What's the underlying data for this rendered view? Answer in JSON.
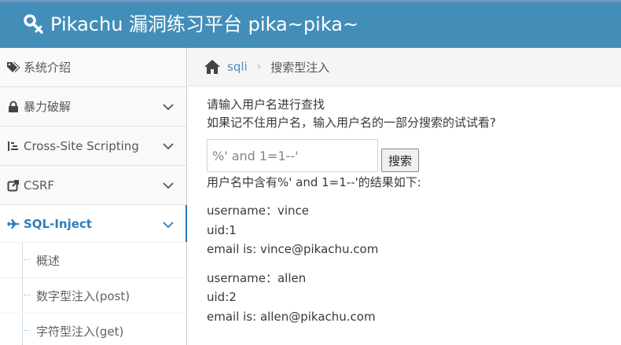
{
  "header": {
    "title": "Pikachu 漏洞练习平台 pika~pika~"
  },
  "sidebar": {
    "items": [
      {
        "label": "系统介绍",
        "icon": "tags-icon",
        "has_chevron": false
      },
      {
        "label": "暴力破解",
        "icon": "lock-icon",
        "has_chevron": true
      },
      {
        "label": "Cross-Site Scripting",
        "icon": "list-icon",
        "has_chevron": true
      },
      {
        "label": "CSRF",
        "icon": "share-icon",
        "has_chevron": true
      },
      {
        "label": "SQL-Inject",
        "icon": "plane-icon",
        "has_chevron": true,
        "active": true
      }
    ],
    "sub_items": [
      {
        "label": "概述"
      },
      {
        "label": "数字型注入(post)"
      },
      {
        "label": "字符型注入(get)"
      }
    ]
  },
  "breadcrumb": {
    "link": "sqli",
    "current": "搜索型注入"
  },
  "main": {
    "prompt_line1": "请输入用户名进行查找",
    "prompt_line2": "如果记不住用户名，输入用户名的一部分搜索的试试看?",
    "search_value": "%' and 1=1--'",
    "search_button": "搜索",
    "result_title": "用户名中含有%' and 1=1--'的结果如下:",
    "records": [
      {
        "username": "username：vince",
        "uid": "uid:1",
        "email": "email is: vince@pikachu.com"
      },
      {
        "username": "username：allen",
        "uid": "uid:2",
        "email": "email is: allen@pikachu.com"
      }
    ]
  },
  "colors": {
    "header_bg": "#438eb9",
    "accent": "#2b7dbc",
    "link": "#4c8fbd"
  }
}
